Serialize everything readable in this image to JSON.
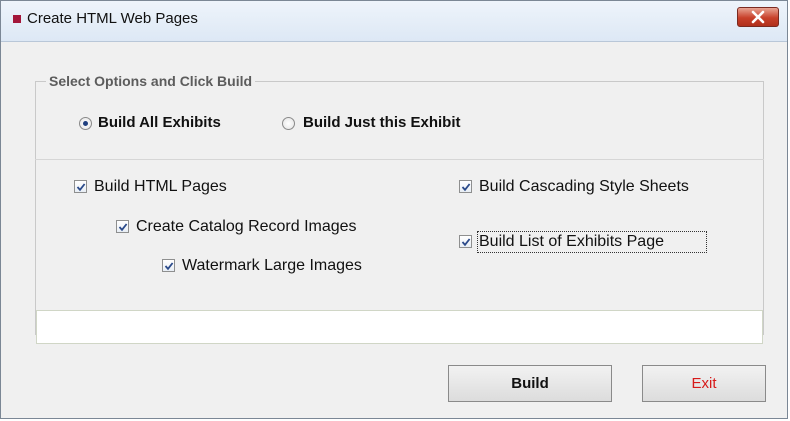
{
  "window": {
    "title": "Create HTML Web Pages",
    "close_glyph": "close-icon"
  },
  "options_group": {
    "legend": "Select Options and Click Build",
    "radios": [
      {
        "label": "Build All Exhibits",
        "selected": true
      },
      {
        "label": "Build Just this Exhibit",
        "selected": false
      }
    ],
    "checkboxes": [
      {
        "label": "Build HTML Pages",
        "checked": true
      },
      {
        "label": "Create Catalog Record Images",
        "checked": true
      },
      {
        "label": "Watermark Large Images",
        "checked": true
      },
      {
        "label": "Build Cascading Style Sheets",
        "checked": true
      },
      {
        "label": "Build List of Exhibits Page",
        "checked": true
      }
    ]
  },
  "progress": {
    "value": 0
  },
  "buttons": {
    "build_label": "Build",
    "exit_label": "Exit"
  },
  "colors": {
    "accent_icon": "#a3163a",
    "exit_text": "#d71a1a",
    "close_button": "#c8402a"
  }
}
